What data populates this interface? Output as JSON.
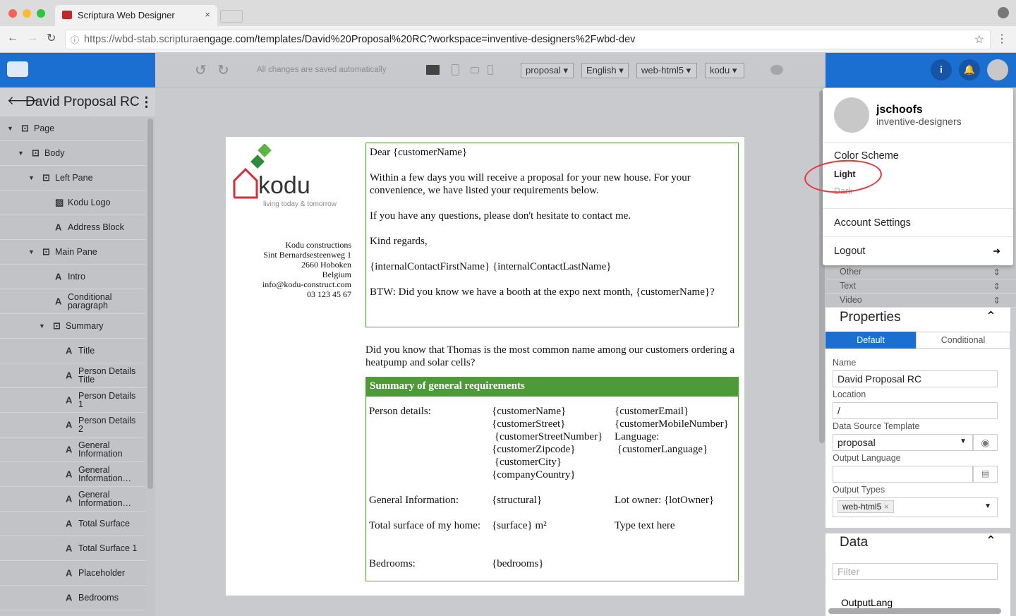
{
  "browser": {
    "tab_title": "Scriptura Web Designer",
    "url_host": "https://wbd-stab.scriptura",
    "url_rest": "engage.com/templates/David%20Proposal%20RC?workspace=inventive-designers%2Fwbd-dev"
  },
  "toolbar": {
    "status": "All changes are saved automatically",
    "selects": [
      "proposal",
      "English",
      "web-html5",
      "kodu"
    ]
  },
  "left": {
    "title": "David Proposal RC",
    "tree": [
      {
        "label": "Page",
        "icon": "container",
        "level": 0,
        "caret": true
      },
      {
        "label": "Body",
        "icon": "container",
        "level": 1,
        "caret": true
      },
      {
        "label": "Left Pane",
        "icon": "container",
        "level": 2,
        "caret": true
      },
      {
        "label": "Kodu Logo",
        "icon": "image",
        "level": 3
      },
      {
        "label": "Address Block",
        "icon": "text",
        "level": 3
      },
      {
        "label": "Main Pane",
        "icon": "container",
        "level": 2,
        "caret": true
      },
      {
        "label": "Intro",
        "icon": "text",
        "level": 3
      },
      {
        "label": "Conditional paragraph",
        "icon": "text",
        "level": 3
      },
      {
        "label": "Summary",
        "icon": "container",
        "level": 3,
        "caret": true
      },
      {
        "label": "Title",
        "icon": "text",
        "level": 4
      },
      {
        "label": "Person Details Title",
        "icon": "text",
        "level": 4
      },
      {
        "label": "Person Details 1",
        "icon": "text",
        "level": 4
      },
      {
        "label": "Person Details 2",
        "icon": "text",
        "level": 4
      },
      {
        "label": "General Information",
        "icon": "text",
        "level": 4
      },
      {
        "label": "General Information…",
        "icon": "text",
        "level": 4
      },
      {
        "label": "General Information…",
        "icon": "text",
        "level": 4
      },
      {
        "label": "Total Surface",
        "icon": "text",
        "level": 4
      },
      {
        "label": "Total Surface 1",
        "icon": "text",
        "level": 4
      },
      {
        "label": "Placeholder",
        "icon": "text",
        "level": 4
      },
      {
        "label": "Bedrooms",
        "icon": "text",
        "level": 4
      }
    ]
  },
  "document": {
    "logo_text": "kodu",
    "logo_tagline": "living today & tomorrow",
    "address": [
      "Kodu constructions",
      "Sint Bernardsesteenweg 1",
      "2660 Hoboken",
      "Belgium",
      "info@kodu-construct.com",
      "03 123 45 67"
    ],
    "intro": [
      "Dear {customerName}",
      "Within a few days you will receive a proposal for your new house. For your convenience, we have listed your requirements below.",
      "If you have any questions, please don't hesitate to contact me.",
      "Kind regards,",
      "{internalContactFirstName} {internalContactLastName}",
      "BTW: Did you know we have a booth at the expo next month, {customerName}?"
    ],
    "conditional": "Did you know that Thomas is the most common name among our customers ordering a heatpump and solar cells?",
    "summary_title": "Summary of general requirements",
    "person_label": "Person details:",
    "person_col1": "{customerName}\n{customerStreet}\n {customerStreetNumber}\n{customerZipcode}\n {customerCity}\n{companyCountry}",
    "person_col2": "{customerEmail}\n{customerMobileNumber}\nLanguage:\n {customerLanguage}",
    "general_label": "General Information:",
    "general_val": "{structural}",
    "lot": "Lot owner: {lotOwner}",
    "surface_label": "Total surface of my home:",
    "surface_val": "{surface} m²",
    "placeholder": "Type text here",
    "bedrooms_label": "Bedrooms:",
    "bedrooms_val": "{bedrooms}"
  },
  "user_menu": {
    "username": "jschoofs",
    "org": "inventive-designers",
    "color_scheme": "Color Scheme",
    "light": "Light",
    "dark": "Dark",
    "account": "Account Settings",
    "logout": "Logout"
  },
  "right": {
    "groups": [
      "Other",
      "Text",
      "Video"
    ],
    "properties_title": "Properties",
    "tab_default": "Default",
    "tab_conditional": "Conditional",
    "name_label": "Name",
    "name_value": "David Proposal RC",
    "location_label": "Location",
    "location_value": "/",
    "dst_label": "Data Source Template",
    "dst_value": "proposal",
    "lang_label": "Output Language",
    "lang_value": "",
    "types_label": "Output Types",
    "types_chip": "web-html5",
    "data_title": "Data",
    "filter_placeholder": "Filter",
    "data_item": "OutputLang"
  },
  "colors": {
    "brand": "#1a6fd0",
    "summary_green": "#4d9b38",
    "annotation": "#e8333a"
  }
}
